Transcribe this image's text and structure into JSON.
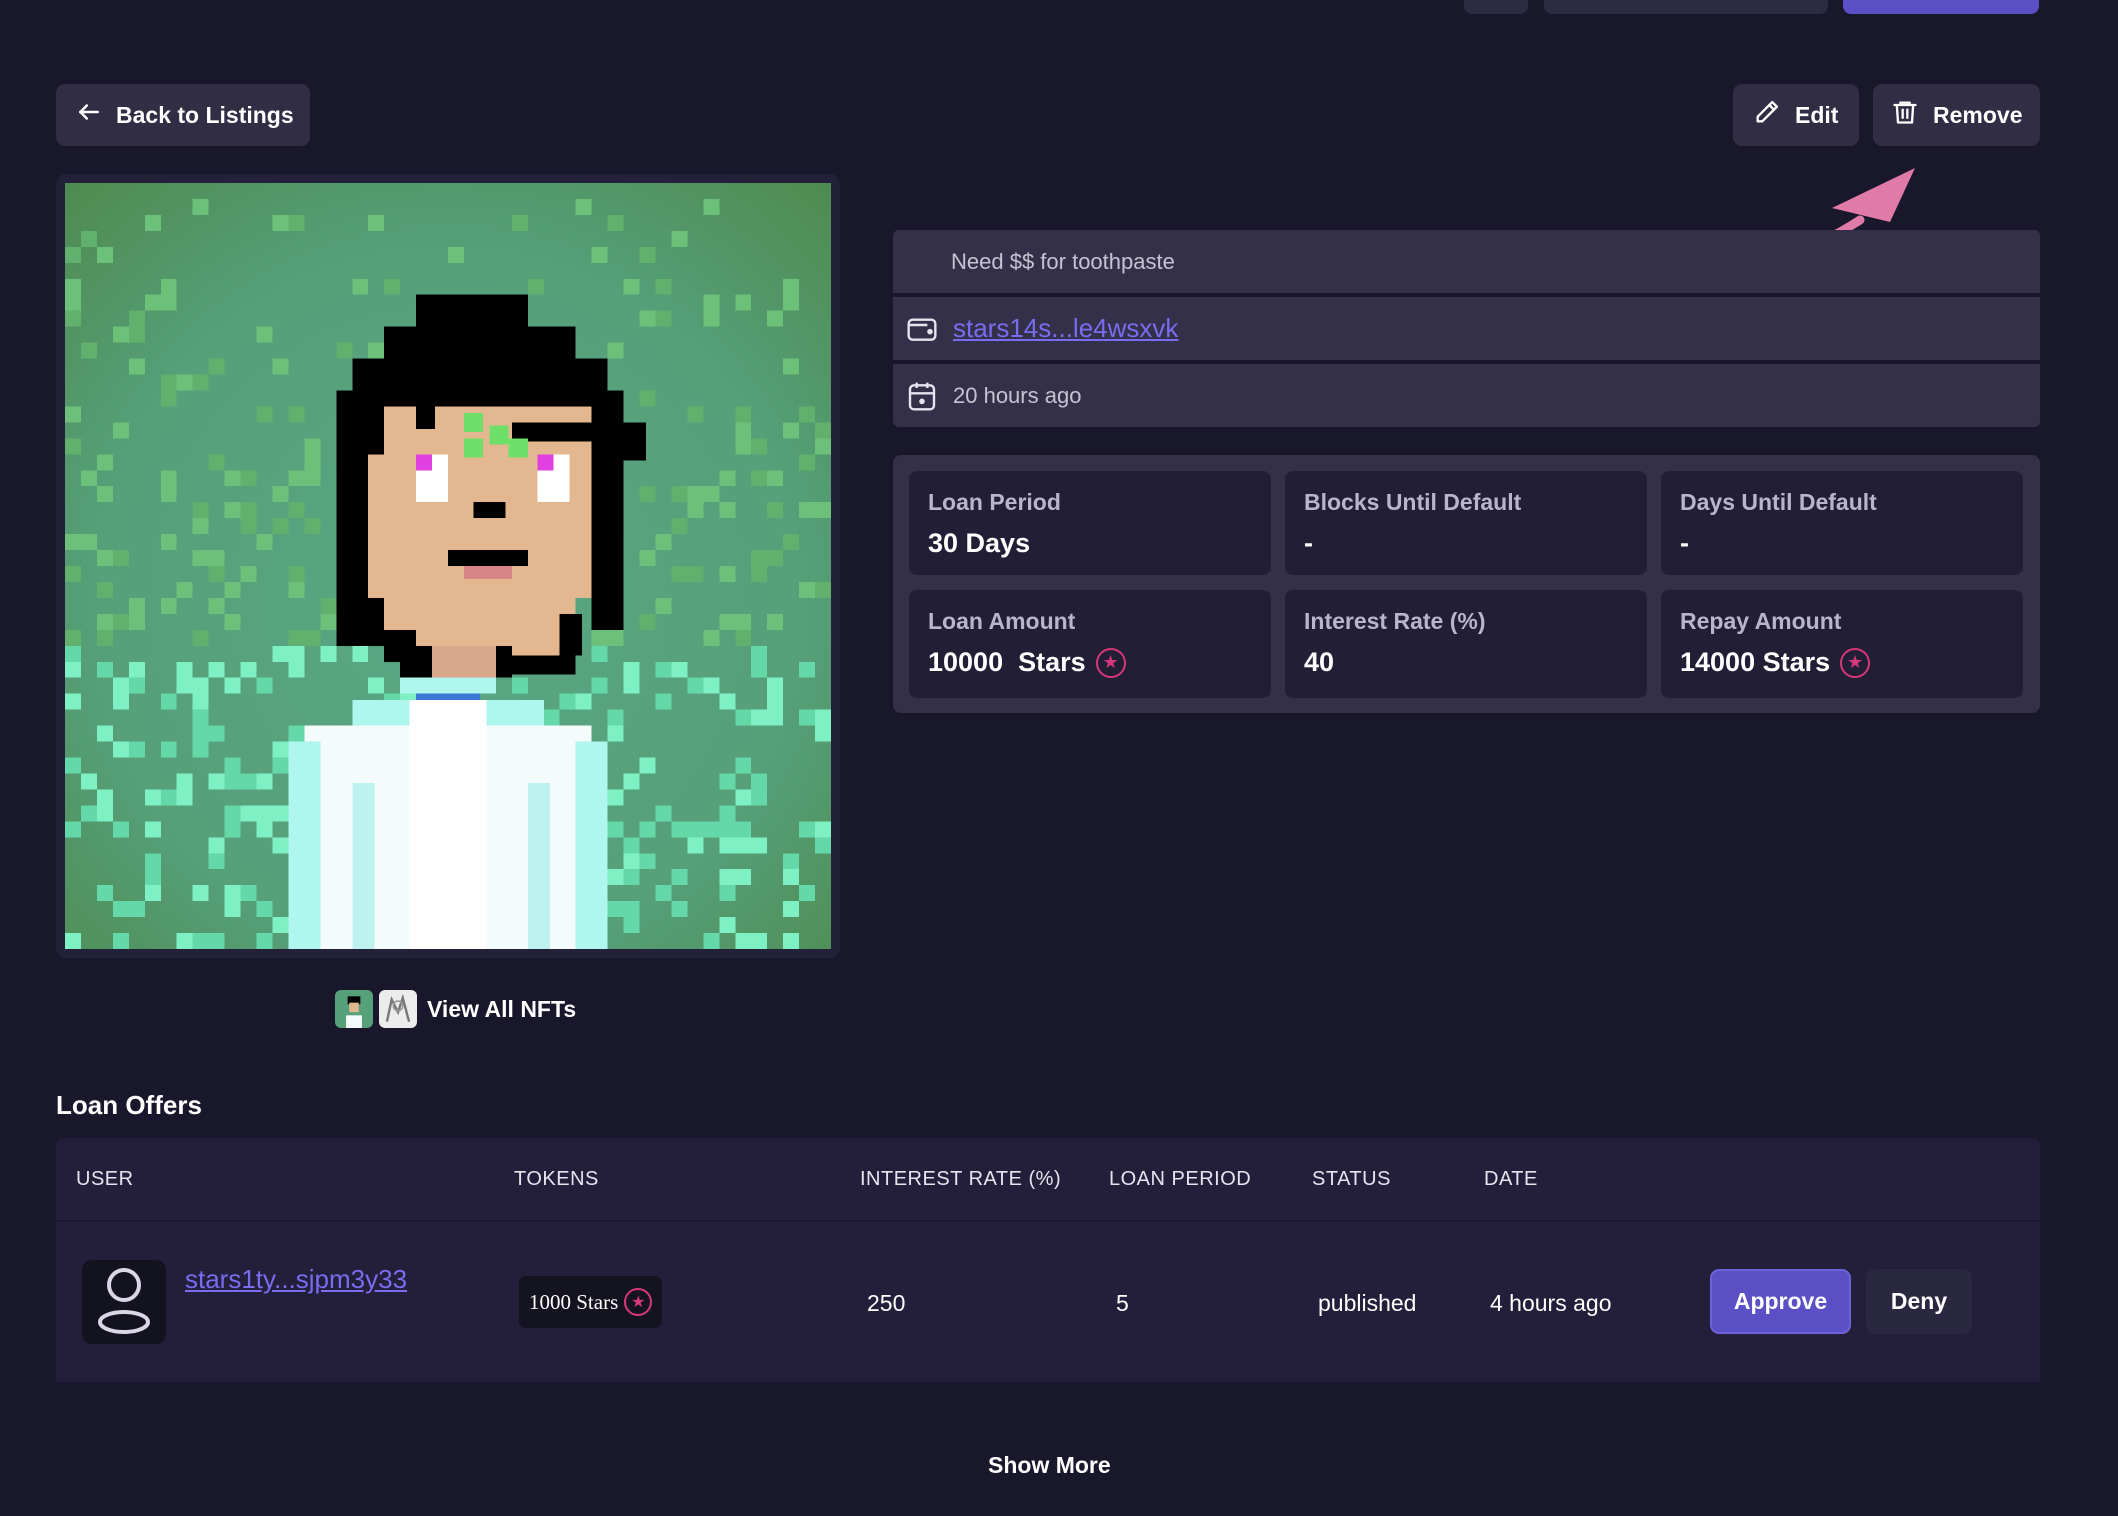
{
  "header": {
    "back_label": "Back to Listings",
    "edit_label": "Edit",
    "remove_label": "Remove"
  },
  "listing": {
    "description": "Need $$ for toothpaste",
    "owner_address": "stars14s...le4wsxvk",
    "posted": "20 hours ago"
  },
  "stats": [
    {
      "label": "Loan Period",
      "value": "30 Days"
    },
    {
      "label": "Blocks Until Default",
      "value": "-"
    },
    {
      "label": "Days Until Default",
      "value": "-"
    },
    {
      "label": "Loan Amount",
      "value": "10000  Stars"
    },
    {
      "label": "Interest Rate (%)",
      "value": "40"
    },
    {
      "label": "Repay Amount",
      "value": "14000 Stars"
    }
  ],
  "view_all_label": "View All NFTs",
  "offers": {
    "title": "Loan Offers",
    "columns": [
      "USER",
      "TOKENS",
      "INTEREST RATE (%)",
      "LOAN PERIOD",
      "STATUS",
      "DATE"
    ],
    "rows": [
      {
        "user": "stars1ty...sjpm3y33",
        "tokens": "1000 Stars",
        "interest_rate": "250",
        "loan_period": "5",
        "status": "published",
        "date": "4 hours ago",
        "approve_label": "Approve",
        "deny_label": "Deny"
      }
    ],
    "show_more_label": "Show More"
  },
  "colors": {
    "background": "#18172b",
    "accent": "#5a4fc4",
    "link": "#7a6cf0",
    "stars_icon": "#d6387a",
    "annotation_arrow": "#e07aa6"
  },
  "icons": [
    "arrow-left-icon",
    "pencil-icon",
    "trash-icon",
    "wallet-icon",
    "calendar-icon",
    "stars-token-icon",
    "user-icon"
  ]
}
